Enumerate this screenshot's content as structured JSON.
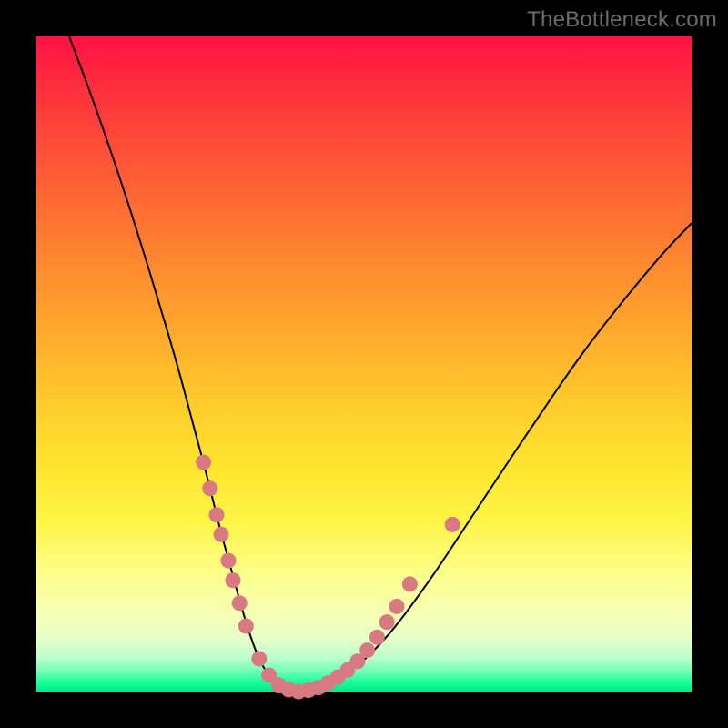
{
  "watermark": "TheBottleneck.com",
  "chart_data": {
    "type": "line",
    "title": "",
    "xlabel": "",
    "ylabel": "",
    "xlim": [
      0,
      100
    ],
    "ylim": [
      0,
      100
    ],
    "curve": {
      "x": [
        5,
        8,
        11,
        14,
        17,
        20,
        22,
        24,
        26,
        28,
        29.5,
        31,
        32.5,
        34,
        35.5,
        37,
        38.5,
        40,
        42,
        45,
        49,
        54,
        60,
        67,
        75,
        84,
        94,
        100
      ],
      "y": [
        100,
        92,
        83.5,
        74.5,
        65,
        55,
        48,
        40.5,
        33,
        25,
        19.5,
        14,
        9,
        5,
        2.5,
        1,
        0.3,
        0,
        0.3,
        1.5,
        4,
        9,
        17,
        27.5,
        39.5,
        52.5,
        65,
        71.5
      ]
    },
    "markers": [
      {
        "x": 25.5,
        "y": 35
      },
      {
        "x": 26.5,
        "y": 31
      },
      {
        "x": 27.5,
        "y": 27
      },
      {
        "x": 28.2,
        "y": 24
      },
      {
        "x": 29.3,
        "y": 20
      },
      {
        "x": 30.0,
        "y": 17
      },
      {
        "x": 31.0,
        "y": 13.5
      },
      {
        "x": 32.0,
        "y": 10
      },
      {
        "x": 34.0,
        "y": 5
      },
      {
        "x": 35.5,
        "y": 2.5
      },
      {
        "x": 37.0,
        "y": 1
      },
      {
        "x": 38.5,
        "y": 0.3
      },
      {
        "x": 40.0,
        "y": 0
      },
      {
        "x": 41.5,
        "y": 0.2
      },
      {
        "x": 43.0,
        "y": 0.6
      },
      {
        "x": 44.5,
        "y": 1.3
      },
      {
        "x": 46.0,
        "y": 2.2
      },
      {
        "x": 47.5,
        "y": 3.3
      },
      {
        "x": 49.0,
        "y": 4.6
      },
      {
        "x": 50.5,
        "y": 6.3
      },
      {
        "x": 52.0,
        "y": 8.3
      },
      {
        "x": 53.5,
        "y": 10.6
      },
      {
        "x": 55.0,
        "y": 13.0
      },
      {
        "x": 57.0,
        "y": 16.4
      },
      {
        "x": 63.5,
        "y": 25.5
      }
    ],
    "colors": {
      "curve": "#000000",
      "marker": "#d97a82"
    }
  }
}
